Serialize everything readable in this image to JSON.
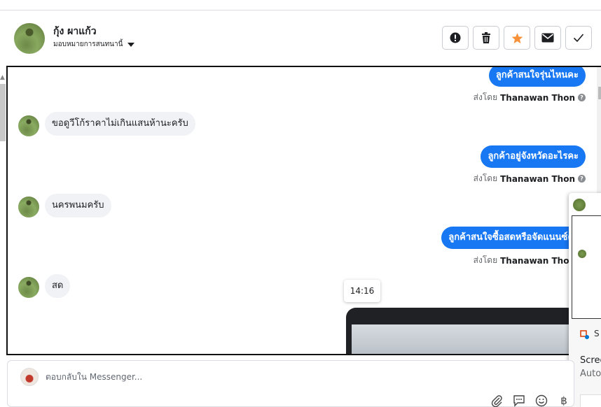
{
  "header": {
    "contact_name": "กุ้ง ผาแก้ว",
    "assign_label": "มอบหมายการสนทนานี้",
    "actions": [
      {
        "name": "mark-spam-button",
        "icon": "exclamation-icon"
      },
      {
        "name": "delete-button",
        "icon": "trash-icon"
      },
      {
        "name": "star-button",
        "icon": "star-icon",
        "color": "#f7923a"
      },
      {
        "name": "mark-unread-button",
        "icon": "envelope-icon"
      },
      {
        "name": "mark-done-button",
        "icon": "check-icon"
      }
    ]
  },
  "conversation": {
    "messages": [
      {
        "direction": "out",
        "text": "ลูกค้าสนใจรุ่นไหนคะ"
      },
      {
        "direction": "in",
        "text": "ขอดูวีโก้ราคาไม่เกินแสนห้านะครับ"
      },
      {
        "direction": "out",
        "text": "ลูกค้าอยู่จังหวัดอะไรคะ"
      },
      {
        "direction": "in",
        "text": "นครพนมครับ"
      },
      {
        "direction": "out",
        "text": "ลูกค้าสนใจซื้อสดหรือจัดแนนซ์คะ"
      },
      {
        "direction": "in",
        "text": "สด"
      }
    ],
    "sent_by_prefix": "ส่งโดย",
    "sent_by_name": "Thanawan Thon",
    "timestamp_tooltip": "14:16"
  },
  "popup": {
    "title_partial": "S",
    "line1": "Scree",
    "line2": "Auto"
  },
  "reply": {
    "placeholder": "ตอบกลับใน Messenger..."
  },
  "colors": {
    "outgoing_bubble": "#1877f2",
    "incoming_bubble": "#f0f2f5",
    "star": "#f7923a"
  }
}
